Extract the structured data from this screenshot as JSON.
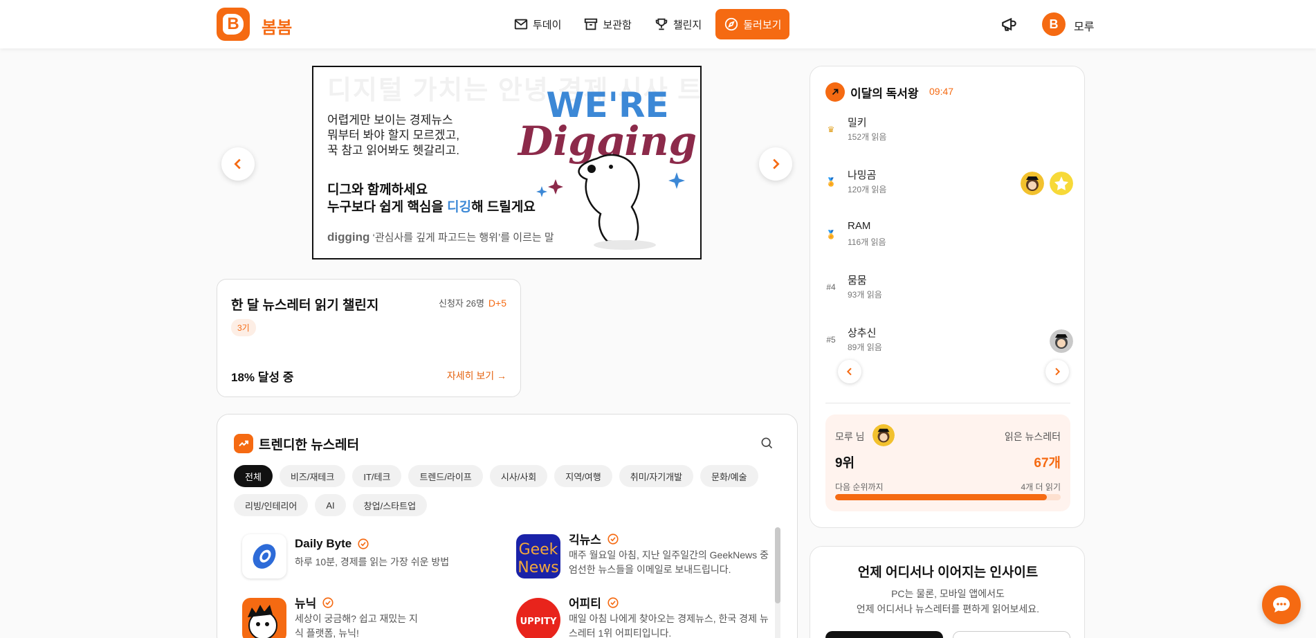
{
  "brand": {
    "name": "봄봄",
    "logo_letter": "B"
  },
  "nav": {
    "items": [
      {
        "label": "투데이",
        "icon": "mail-icon"
      },
      {
        "label": "보관함",
        "icon": "archive-icon"
      },
      {
        "label": "챌린지",
        "icon": "trophy-icon"
      },
      {
        "label": "둘러보기",
        "icon": "compass-icon",
        "active": true
      }
    ]
  },
  "user": {
    "avatar_letter": "B",
    "name": "모루"
  },
  "banner": {
    "ghost": "디지털 가치는 안녕 경제 시사 트렌드",
    "line1": "어렵게만 보이는 경제뉴스",
    "line2": "뭐부터 봐야 할지 모르겠고,",
    "line3": "꾹 참고 읽어봐도 헷갈리고.",
    "bold1": "디그와 함께하세요",
    "bold2_pre": "누구보다 쉽게 핵심을",
    "bold2_hl": "디깅",
    "bold2_post": "해 드릴게요",
    "foot_word": "digging",
    "foot_desc": "‘관심사를 깊게 파고드는 행위’를 이르는 말",
    "art_line1": "WE'RE",
    "art_line2": "Digging"
  },
  "challenge": {
    "title": "한 달 뉴스레터 읽기 챌린지",
    "applicants": "신청자 26명",
    "dday": "D+5",
    "cohort": "3기",
    "progress_text": "18% 달성 중",
    "link": "자세히 보기 →"
  },
  "trending": {
    "title": "트렌디한 뉴스레터",
    "categories": [
      "전체",
      "비즈/재테크",
      "IT/테크",
      "트렌드/라이프",
      "시사/사회",
      "지역/여행",
      "취미/자기개발",
      "문화/예술",
      "리빙/인테리어",
      "AI",
      "창업/스타트업"
    ],
    "newsletters": [
      {
        "name": "Daily Byte",
        "desc": "하루 10분, 경제를 읽는 가장 쉬운 방법"
      },
      {
        "name": "긱뉴스",
        "desc": "매주 월요일 아침, 지난 일주일간의 GeekNews 중 엄선한 뉴스들을 이메일로 보내드립니다.",
        "logo_text1": "Geek",
        "logo_text2": "News"
      },
      {
        "name": "뉴닉",
        "desc": "세상이 궁금해? 쉽고 재밌는 지식 플랫폼, 뉴닉!"
      },
      {
        "name": "어피티",
        "desc": "매일 아침 나에게 찾아오는 경제뉴스, 한국 경제 뉴스레터 1위 어피티입니다.",
        "logo_text": "UPPITY"
      }
    ]
  },
  "ranking": {
    "title": "이달의 독서왕",
    "time": "09:47",
    "rows": [
      {
        "mark": "♛",
        "name": "밀키",
        "count": "152개 읽음"
      },
      {
        "mark": "🏅",
        "name": "나밍곰",
        "count": "120개 읽음"
      },
      {
        "mark": "🏅",
        "name": "RAM",
        "count": "116개 읽음"
      },
      {
        "mark": "#4",
        "name": "뭄뭄",
        "count": "93개 읽음"
      },
      {
        "mark": "#5",
        "name": "상추신",
        "count": "89개 읽음"
      }
    ],
    "me": {
      "label": "모루 님",
      "read_label": "읽은 뉴스레터",
      "rank": "9위",
      "read_count": "67개",
      "next_label": "다음 순위까지",
      "next_value": "4개 더 읽기",
      "progress": 0.94
    }
  },
  "promo": {
    "title": "언제 어디서나 이어지는 인사이트",
    "desc1": "PC는 물론, 모바일 앱에서도",
    "desc2": "언제 어디서나 뉴스레터를 편하게 읽어보세요."
  },
  "colors": {
    "accent": "#f56a12"
  }
}
